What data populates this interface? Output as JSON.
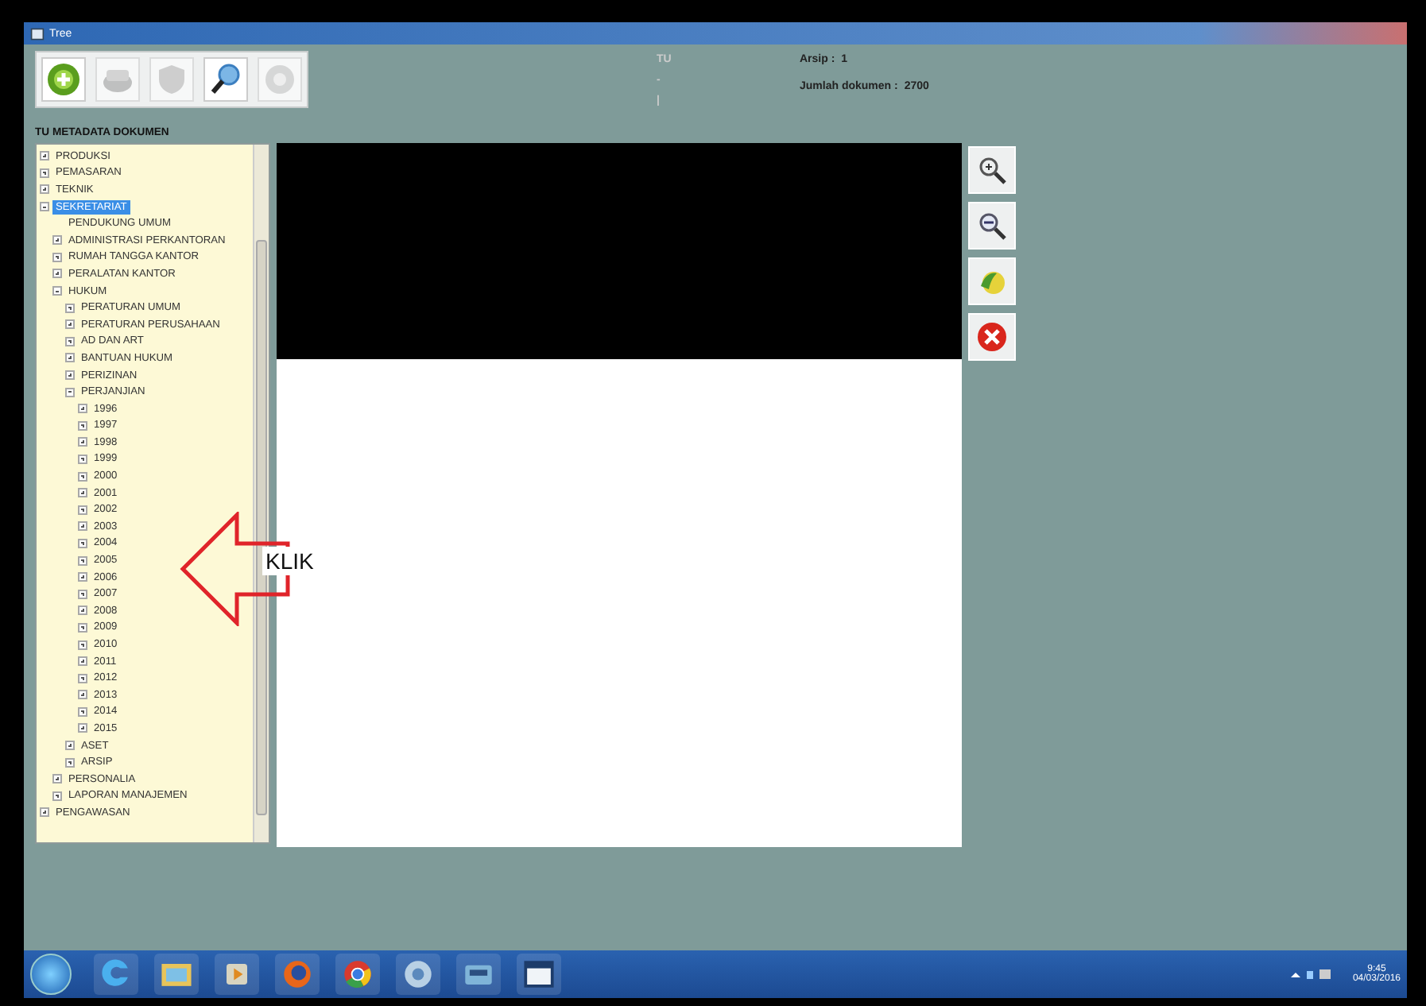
{
  "window": {
    "title": "Tree"
  },
  "toolbar": {
    "buttons": [
      {
        "kind": "add",
        "disabled": false
      },
      {
        "kind": "save",
        "disabled": true
      },
      {
        "kind": "shield",
        "disabled": true
      },
      {
        "kind": "search",
        "disabled": false
      },
      {
        "kind": "gear",
        "disabled": true
      }
    ]
  },
  "info": {
    "code": "TU",
    "marks": [
      "-",
      "|"
    ],
    "fields": [
      {
        "label": "Arsip :",
        "value": "1"
      },
      {
        "label": "Jumlah dokumen :",
        "value": "2700"
      }
    ]
  },
  "tree_title": "TU METADATA DOKUMEN",
  "tree": [
    {
      "label": "PRODUKSI",
      "expanded": false,
      "selected": false
    },
    {
      "label": "PEMASARAN",
      "expanded": false,
      "selected": false
    },
    {
      "label": "TEKNIK",
      "expanded": false,
      "selected": false
    },
    {
      "label": "SEKRETARIAT",
      "expanded": true,
      "selected": true,
      "children": [
        {
          "label": "PENDUKUNG UMUM",
          "selected": false
        },
        {
          "label": "ADMINISTRASI PERKANTORAN",
          "expanded": false,
          "selected": false
        },
        {
          "label": "RUMAH TANGGA KANTOR",
          "expanded": false,
          "selected": false
        },
        {
          "label": "PERALATAN KANTOR",
          "expanded": false,
          "selected": false
        },
        {
          "label": "HUKUM",
          "expanded": true,
          "selected": false,
          "children": [
            {
              "label": "PERATURAN UMUM",
              "expanded": false,
              "selected": false
            },
            {
              "label": "PERATURAN PERUSAHAAN",
              "expanded": false,
              "selected": false
            },
            {
              "label": "AD DAN ART",
              "expanded": false,
              "selected": false
            },
            {
              "label": "BANTUAN HUKUM",
              "expanded": false,
              "selected": false
            },
            {
              "label": "PERIZINAN",
              "expanded": false,
              "selected": false
            },
            {
              "label": "PERJANJIAN",
              "expanded": true,
              "selected": false,
              "children": [
                {
                  "label": "1996",
                  "expanded": false,
                  "selected": false
                },
                {
                  "label": "1997",
                  "expanded": false,
                  "selected": false
                },
                {
                  "label": "1998",
                  "expanded": false,
                  "selected": false
                },
                {
                  "label": "1999",
                  "expanded": false,
                  "selected": false
                },
                {
                  "label": "2000",
                  "expanded": false,
                  "selected": false
                },
                {
                  "label": "2001",
                  "expanded": false,
                  "selected": false
                },
                {
                  "label": "2002",
                  "expanded": false,
                  "selected": false
                },
                {
                  "label": "2003",
                  "expanded": false,
                  "selected": false
                },
                {
                  "label": "2004",
                  "expanded": false,
                  "selected": false
                },
                {
                  "label": "2005",
                  "expanded": false,
                  "selected": false
                },
                {
                  "label": "2006",
                  "expanded": false,
                  "selected": false
                },
                {
                  "label": "2007",
                  "expanded": false,
                  "selected": false
                },
                {
                  "label": "2008",
                  "expanded": false,
                  "selected": false
                },
                {
                  "label": "2009",
                  "expanded": false,
                  "selected": false
                },
                {
                  "label": "2010",
                  "expanded": false,
                  "selected": false
                },
                {
                  "label": "2011",
                  "expanded": false,
                  "selected": false
                },
                {
                  "label": "2012",
                  "expanded": false,
                  "selected": false
                },
                {
                  "label": "2013",
                  "expanded": false,
                  "selected": false
                },
                {
                  "label": "2014",
                  "expanded": false,
                  "selected": false
                },
                {
                  "label": "2015",
                  "expanded": false,
                  "selected": false
                }
              ]
            },
            {
              "label": "ASET",
              "expanded": false,
              "selected": false
            },
            {
              "label": "ARSIP",
              "expanded": false,
              "selected": false
            }
          ]
        },
        {
          "label": "PERSONALIA",
          "expanded": false,
          "selected": false
        },
        {
          "label": "LAPORAN MANAJEMEN",
          "expanded": false,
          "selected": false
        }
      ]
    },
    {
      "label": "PENGAWASAN",
      "expanded": false,
      "selected": false
    }
  ],
  "viewer_tools": [
    {
      "kind": "zoom-in"
    },
    {
      "kind": "zoom-out"
    },
    {
      "kind": "pan"
    },
    {
      "kind": "close"
    }
  ],
  "annotation": {
    "label": "KLIK"
  },
  "taskbar": {
    "apps": [
      {
        "kind": "ie"
      },
      {
        "kind": "folder"
      },
      {
        "kind": "media"
      },
      {
        "kind": "firefox"
      },
      {
        "kind": "chrome"
      },
      {
        "kind": "app"
      },
      {
        "kind": "scanner"
      },
      {
        "kind": "window"
      }
    ],
    "time": "9:45",
    "date": "04/03/2016"
  }
}
